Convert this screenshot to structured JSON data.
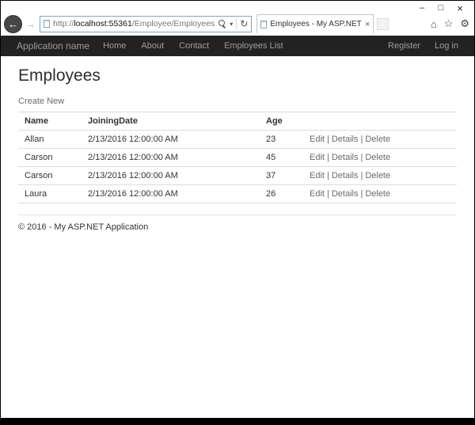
{
  "browser": {
    "url_prefix": "http://",
    "url_host": "localhost:55361",
    "url_path": "/Employee/Employees",
    "tab_title": "Employees - My ASP.NET A..."
  },
  "icons": {
    "back": "←",
    "forward": "→",
    "minimize": "–",
    "maximize": "□",
    "close": "×",
    "search": "magnifier-css-shape",
    "dropdown": "▾",
    "refresh": "↻",
    "home": "⌂",
    "favorites": "☆",
    "settings": "⚙"
  },
  "navbar": {
    "brand": "Application name",
    "links": [
      "Home",
      "About",
      "Contact",
      "Employees List"
    ],
    "right_links": [
      "Register",
      "Log in"
    ]
  },
  "page": {
    "title": "Employees",
    "create_link": "Create New"
  },
  "table": {
    "headers": [
      "Name",
      "JoiningDate",
      "Age",
      ""
    ],
    "actions": {
      "edit": "Edit",
      "details": "Details",
      "delete": "Delete",
      "separator": "|"
    },
    "rows": [
      {
        "name": "Allan",
        "joining_date": "2/13/2016 12:00:00 AM",
        "age": "23"
      },
      {
        "name": "Carson",
        "joining_date": "2/13/2016 12:00:00 AM",
        "age": "45"
      },
      {
        "name": "Carson",
        "joining_date": "2/13/2016 12:00:00 AM",
        "age": "37"
      },
      {
        "name": "Laura",
        "joining_date": "2/13/2016 12:00:00 AM",
        "age": "26"
      }
    ]
  },
  "footer": {
    "copyright": "© 2016 - My ASP.NET Application"
  },
  "colors": {
    "navbar_bg": "#222222",
    "navbar_text": "#9d9d9d",
    "link": "#6d6b66",
    "table_border": "#dddddd",
    "addressbar_border": "#79a7c6"
  }
}
